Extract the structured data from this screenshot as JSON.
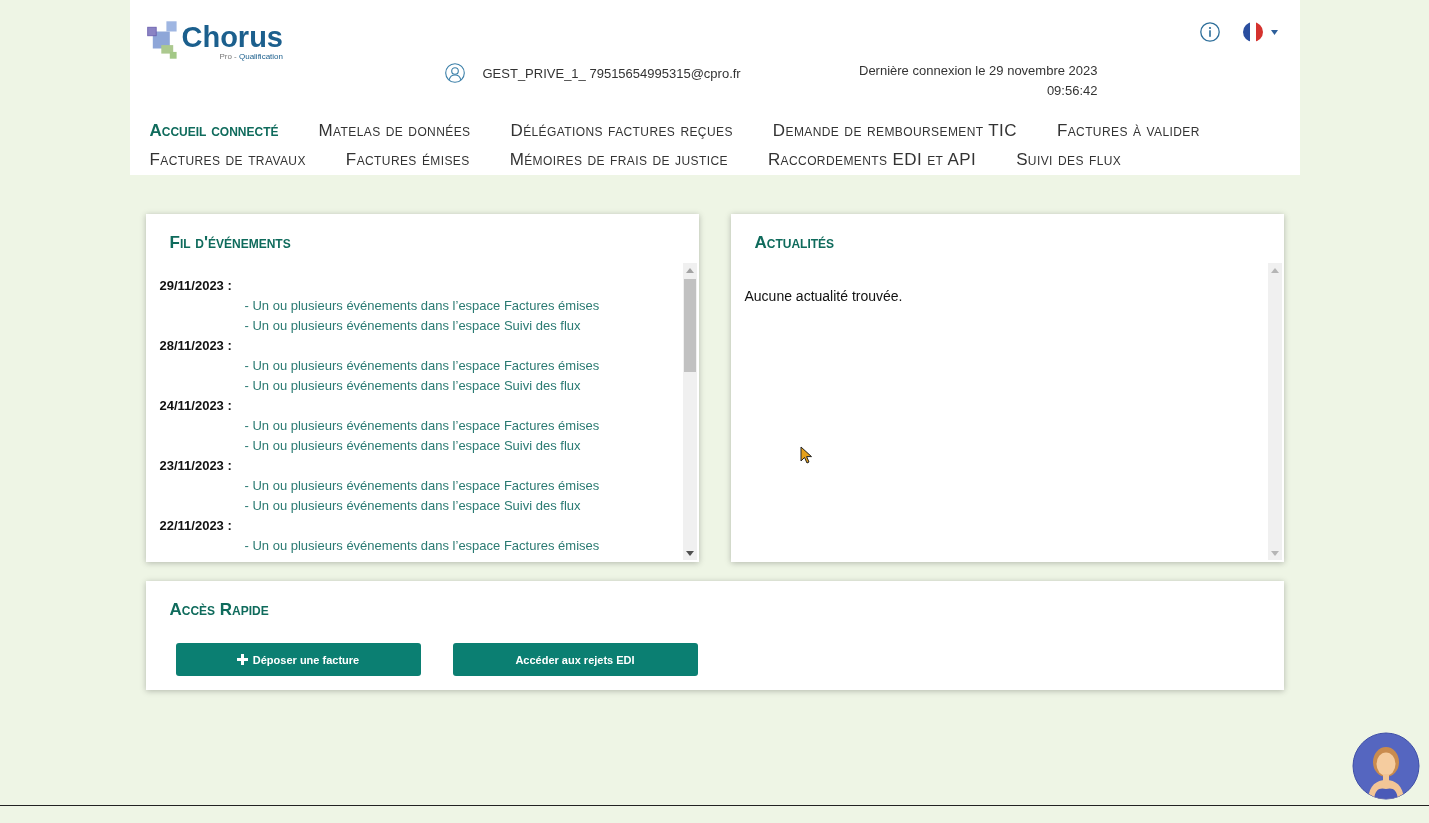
{
  "header": {
    "logo": {
      "name": "Chorus",
      "product": "Pro -",
      "environment": "Qualification"
    },
    "user": "GEST_PRIVE_1_ 79515654995315@cpro.fr",
    "last_login": {
      "date": "Dernière connexion le 29 novembre 2023",
      "time": "09:56:42"
    }
  },
  "nav": [
    {
      "label": "Accueil connecté",
      "selected": true
    },
    {
      "label": "Matelas de données",
      "selected": false
    },
    {
      "label": "Délégations factures reçues",
      "selected": false
    },
    {
      "label": "Demande de remboursement TIC",
      "selected": false
    },
    {
      "label": "Factures à valider",
      "selected": false
    },
    {
      "label": "Factures de travaux",
      "selected": false
    },
    {
      "label": "Factures émises",
      "selected": false
    },
    {
      "label": "Mémoires de frais de justice",
      "selected": false
    },
    {
      "label": "Raccordements EDI et API",
      "selected": false
    },
    {
      "label": "Suivi des flux",
      "selected": false
    }
  ],
  "events_panel": {
    "title": "Fil d'événements",
    "days": [
      {
        "date": "29/11/2023 :",
        "events": [
          "- Un ou plusieurs événements dans l’espace Factures émises",
          "- Un ou plusieurs événements dans l’espace Suivi des flux"
        ]
      },
      {
        "date": "28/11/2023 :",
        "events": [
          "- Un ou plusieurs événements dans l’espace Factures émises",
          "- Un ou plusieurs événements dans l’espace Suivi des flux"
        ]
      },
      {
        "date": "24/11/2023 :",
        "events": [
          "- Un ou plusieurs événements dans l’espace Factures émises",
          "- Un ou plusieurs événements dans l’espace Suivi des flux"
        ]
      },
      {
        "date": "23/11/2023 :",
        "events": [
          "- Un ou plusieurs événements dans l’espace Factures émises",
          "- Un ou plusieurs événements dans l’espace Suivi des flux"
        ]
      },
      {
        "date": "22/11/2023 :",
        "events": [
          "- Un ou plusieurs événements dans l’espace Factures émises"
        ]
      }
    ]
  },
  "news_panel": {
    "title": "Actualités",
    "message": "Aucune actualité trouvée."
  },
  "quick_access": {
    "title": "Accès Rapide",
    "buttons": [
      {
        "label": "Déposer une facture",
        "kind": "add"
      },
      {
        "label": "Accéder aux rejets EDI",
        "kind": "plain"
      }
    ]
  }
}
